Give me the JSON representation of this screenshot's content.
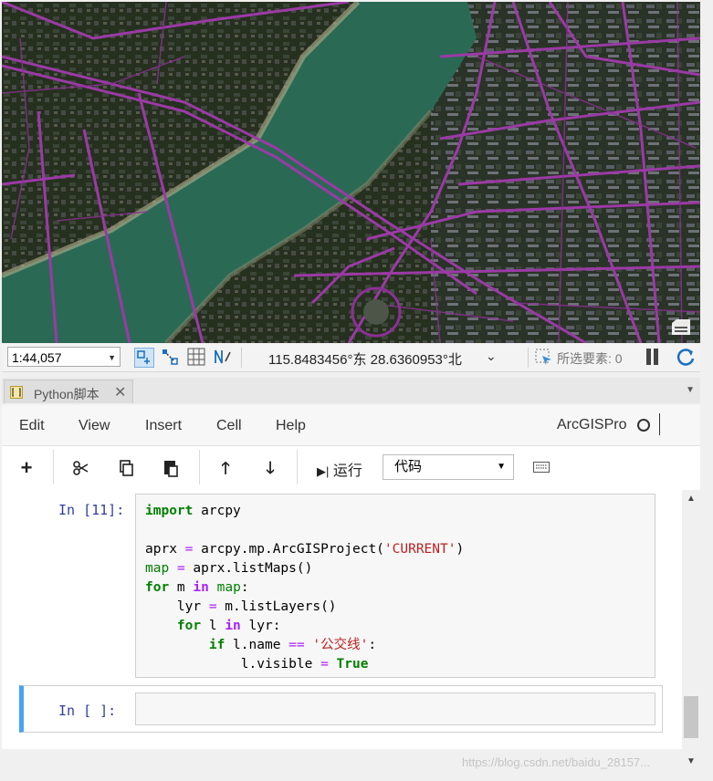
{
  "map": {
    "scale": "1:44,057",
    "coordinates": "115.8483456°东 28.6360953°北",
    "selected_features": "所选要素: 0",
    "icons": [
      "map-nav-icon",
      "snapping-icon",
      "grid-icon",
      "constraint-icon",
      "select-icon",
      "pause-icon",
      "refresh-icon",
      "layout-icon"
    ]
  },
  "tab": {
    "label": "Python脚本",
    "close": "✕"
  },
  "menu": {
    "items": [
      "Edit",
      "View",
      "Insert",
      "Cell",
      "Help"
    ],
    "kernel": "ArcGISPro"
  },
  "toolbar": {
    "add": "+",
    "run": "运行",
    "cell_type": "代码"
  },
  "cells": [
    {
      "prompt": "In  [11]:",
      "lines": [
        "import arcpy",
        "",
        "aprx = arcpy.mp.ArcGISProject('CURRENT')",
        "map = aprx.listMaps()",
        "for m in map:",
        "    lyr = m.listLayers()",
        "    for l in lyr:",
        "        if l.name == '公交线':",
        "            l.visible = True"
      ]
    },
    {
      "prompt": "In  [ ]:",
      "lines": []
    }
  ],
  "watermark": "https://blog.csdn.net/baidu_28157..."
}
